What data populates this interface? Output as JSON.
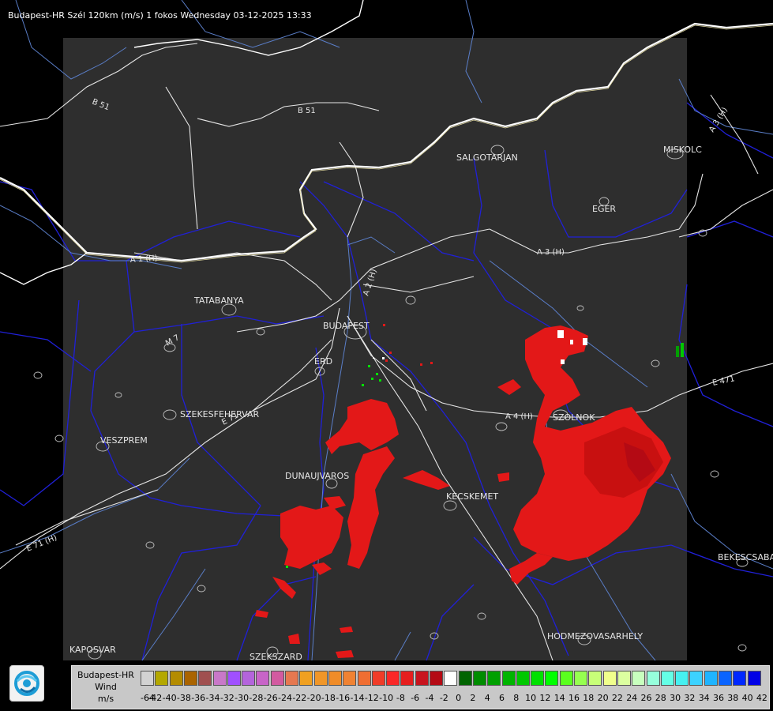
{
  "header": {
    "title": "Budapest-HR Szél 120km (m/s) 1 fokos Wednesday 03-12-2025 13:33"
  },
  "cities": [
    {
      "id": "salgotarjan",
      "name": "SALGOTARJAN"
    },
    {
      "id": "miskolc",
      "name": "MISKOLC"
    },
    {
      "id": "eger",
      "name": "EGER"
    },
    {
      "id": "tatabanya",
      "name": "TATABANYA"
    },
    {
      "id": "budapest",
      "name": "BUDAPEST"
    },
    {
      "id": "erd",
      "name": "ERD"
    },
    {
      "id": "szekesfehervar",
      "name": "SZEKESFEHERVAR"
    },
    {
      "id": "veszprem",
      "name": "VESZPREM"
    },
    {
      "id": "dunaujvaros",
      "name": "DUNAUJVAROS"
    },
    {
      "id": "kecskemet",
      "name": "KECSKEMET"
    },
    {
      "id": "szolnok",
      "name": "SZOLNOK"
    },
    {
      "id": "bekescsaba",
      "name": "BEKESCSABA"
    },
    {
      "id": "hodmezovasarhely",
      "name": "HODMEZOVASARHELY"
    },
    {
      "id": "kaposvar",
      "name": "KAPOSVAR"
    },
    {
      "id": "szekszard",
      "name": "SZEKSZARD"
    }
  ],
  "roads": [
    {
      "id": "b51-west",
      "name": "B 51"
    },
    {
      "id": "b51-east",
      "name": "B 51"
    },
    {
      "id": "a1",
      "name": "A 1 (H)"
    },
    {
      "id": "a2",
      "name": "A 2 (H)"
    },
    {
      "id": "a3",
      "name": "A 3 (H)"
    },
    {
      "id": "a3-ne",
      "name": "A 3 (H)"
    },
    {
      "id": "a4",
      "name": "A 4 (H)"
    },
    {
      "id": "e71-ne",
      "name": "E 71"
    },
    {
      "id": "e71-sw",
      "name": "E 71 (H)"
    },
    {
      "id": "e471",
      "name": "E 471"
    },
    {
      "id": "m7",
      "name": "M 7"
    }
  ],
  "legend": {
    "title": [
      "Budapest-HR",
      "Wind",
      "m/s"
    ],
    "ticks": [
      "-64",
      "-42",
      "-40",
      "-38",
      "-36",
      "-34",
      "-32",
      "-30",
      "-28",
      "-26",
      "-24",
      "-22",
      "-20",
      "-18",
      "-16",
      "-14",
      "-12",
      "-10",
      "-8",
      "-6",
      "-4",
      "-2",
      "0",
      "2",
      "4",
      "6",
      "8",
      "10",
      "12",
      "14",
      "16",
      "18",
      "20",
      "22",
      "24",
      "26",
      "28",
      "30",
      "32",
      "34",
      "36",
      "38",
      "40",
      "42"
    ],
    "colors": [
      "#d2d2d2",
      "#b4a800",
      "#b48c00",
      "#aa6400",
      "#a05050",
      "#c878c8",
      "#a050ff",
      "#b464dc",
      "#c864c8",
      "#d25aa0",
      "#e67850",
      "#f0a020",
      "#f09628",
      "#f08c28",
      "#f08232",
      "#f06e32",
      "#f03c28",
      "#fa2828",
      "#e61e1e",
      "#c8141e",
      "#b40a14",
      "#ffffff",
      "#006400",
      "#008c00",
      "#00a000",
      "#00b400",
      "#00c800",
      "#00e100",
      "#00ff00",
      "#5aff1e",
      "#96ff50",
      "#c8ff78",
      "#f0ff8c",
      "#dcffa0",
      "#c8ffbe",
      "#96ffdc",
      "#64ffe6",
      "#46f0f0",
      "#3cd2ff",
      "#1eb4ff",
      "#0a64ff",
      "#0028ff",
      "#0000e6"
    ]
  }
}
